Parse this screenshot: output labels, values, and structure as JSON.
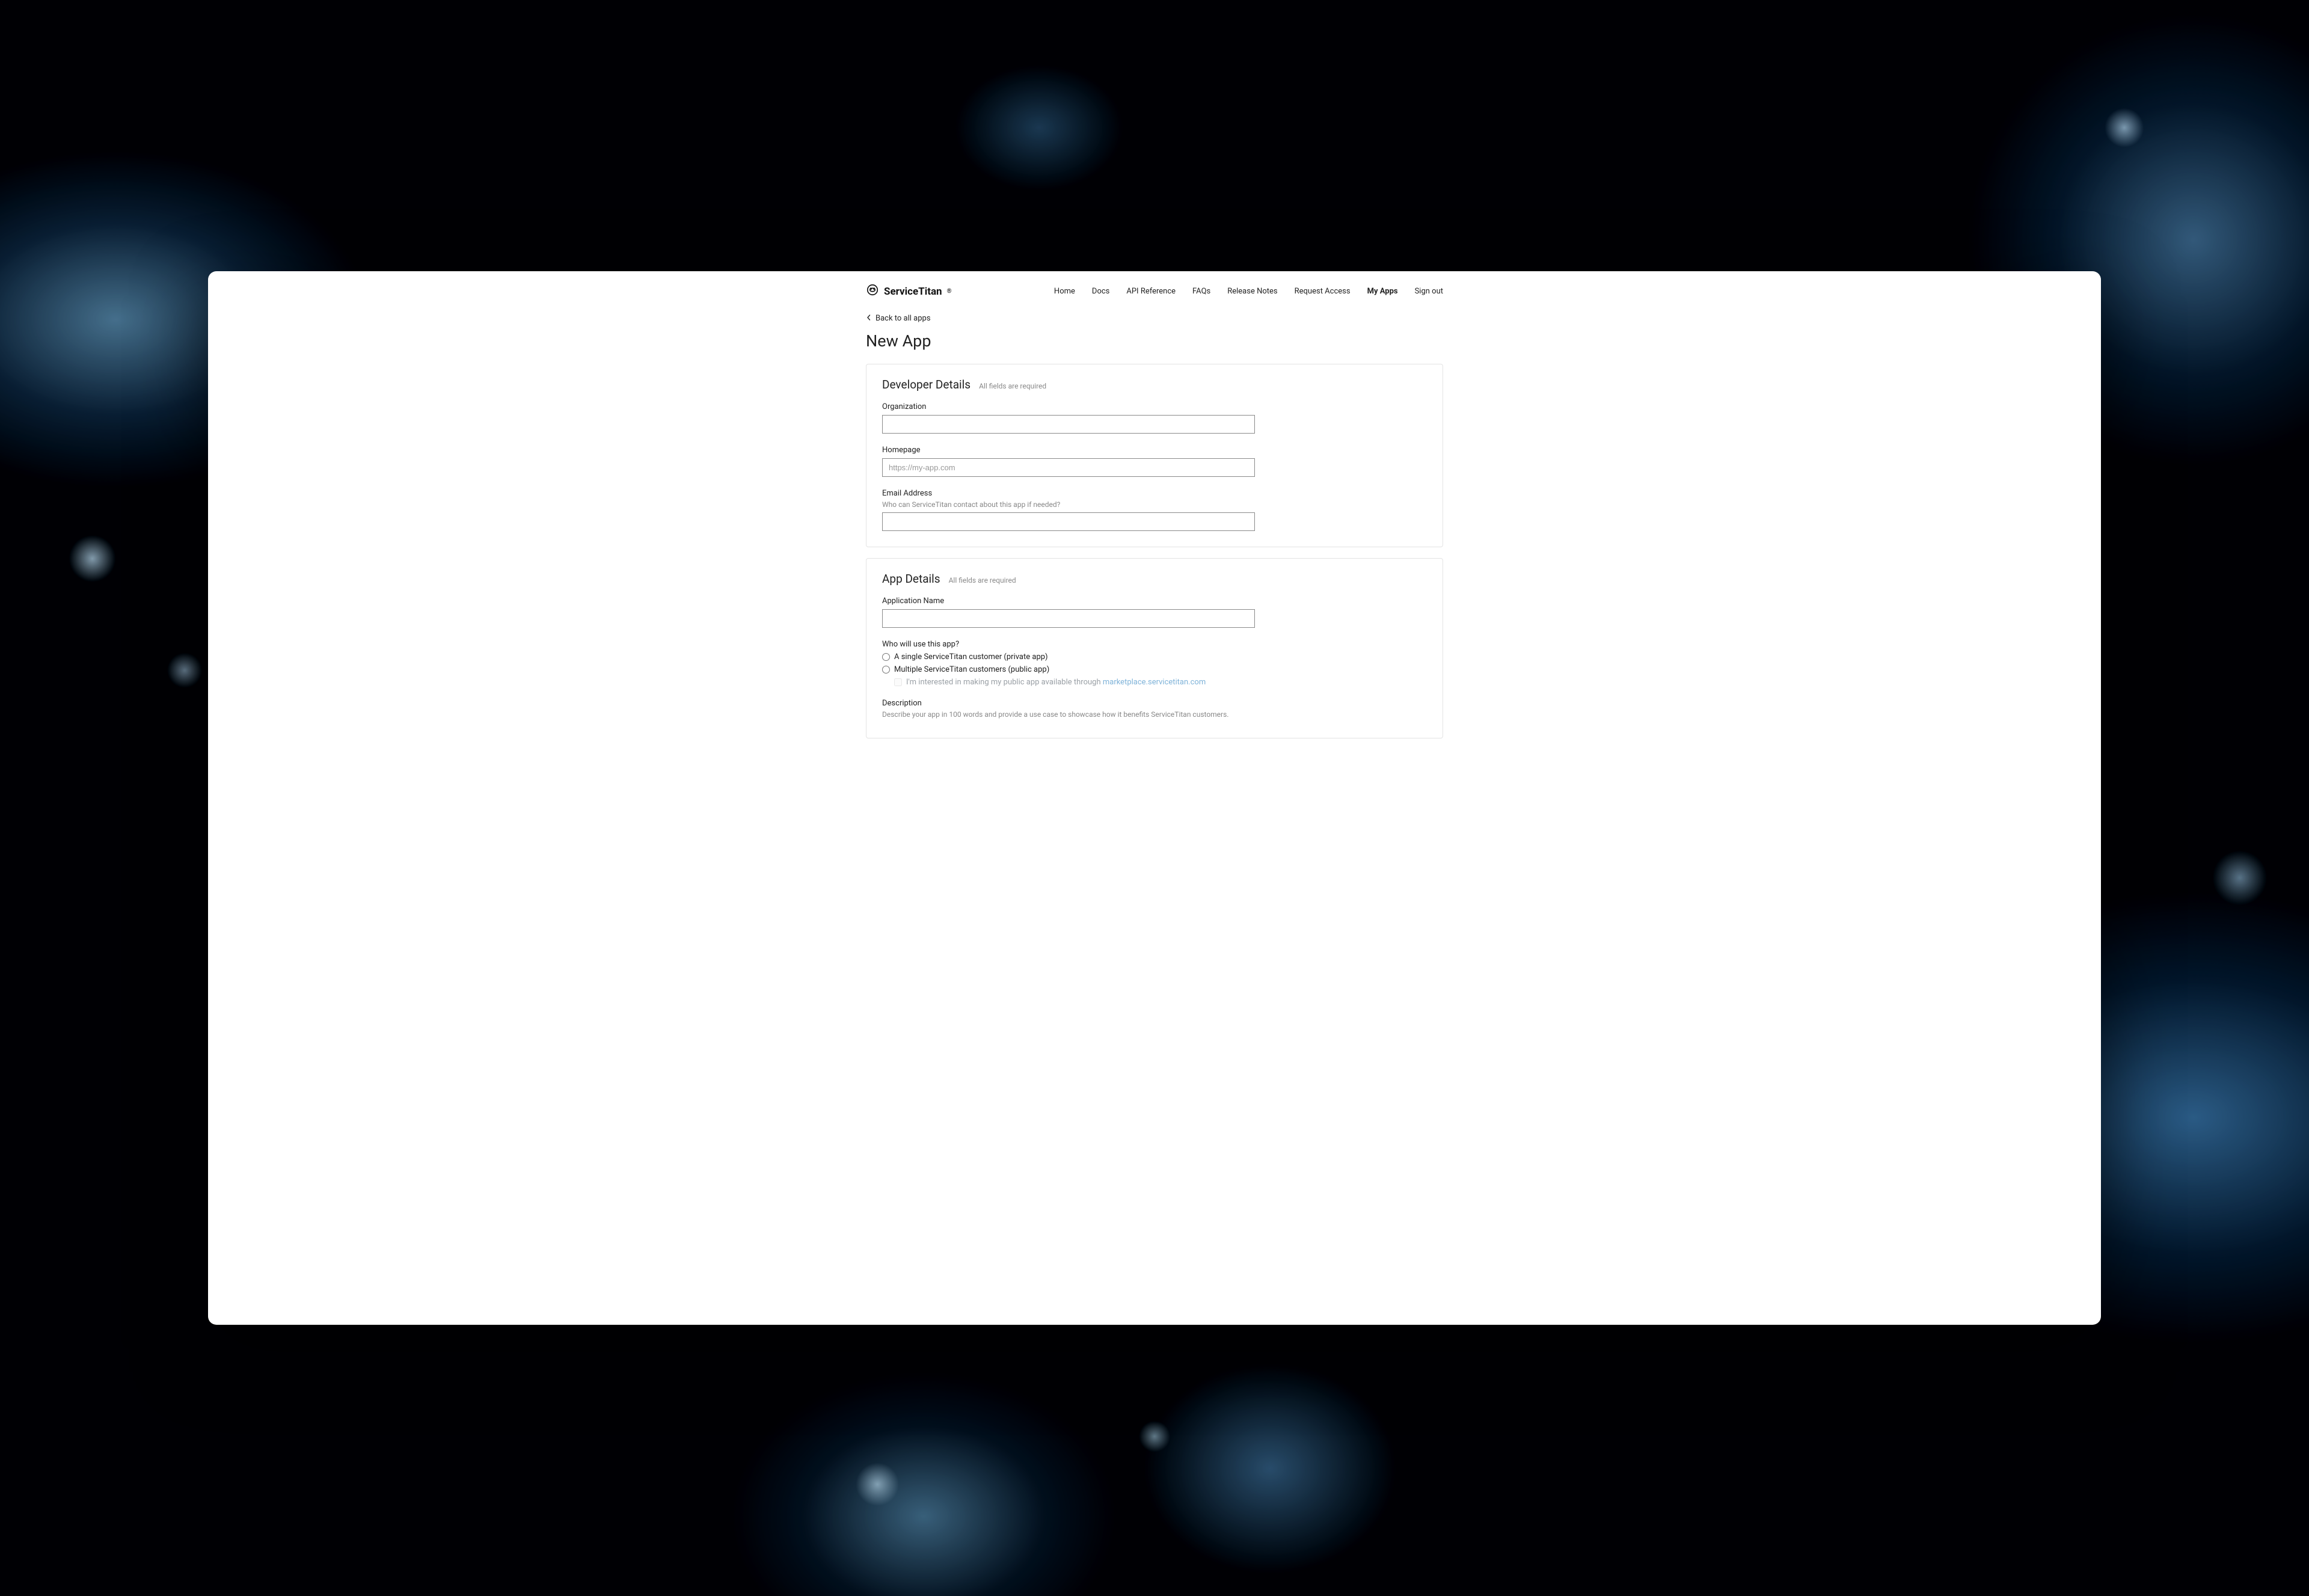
{
  "brand": "ServiceTitan",
  "nav": {
    "home": "Home",
    "docs": "Docs",
    "api_reference": "API Reference",
    "faqs": "FAQs",
    "release_notes": "Release Notes",
    "request_access": "Request Access",
    "my_apps": "My Apps",
    "sign_out": "Sign out"
  },
  "back_link": "Back to all apps",
  "page_title": "New App",
  "developer_details": {
    "title": "Developer Details",
    "note": "All fields are required",
    "organization_label": "Organization",
    "homepage_label": "Homepage",
    "homepage_placeholder": "https://my-app.com",
    "email_label": "Email Address",
    "email_help": "Who can ServiceTitan contact about this app if needed?"
  },
  "app_details": {
    "title": "App Details",
    "note": "All fields are required",
    "application_name_label": "Application Name",
    "who_use_label": "Who will use this app?",
    "option_private": "A single ServiceTitan customer (private app)",
    "option_public": "Multiple ServiceTitan customers (public app)",
    "marketplace_prefix": "I'm interested in making my public app available through ",
    "marketplace_link": "marketplace.servicetitan.com",
    "description_label": "Description",
    "description_help": "Describe your app in 100 words and provide a use case to showcase how it benefits ServiceTitan customers."
  }
}
